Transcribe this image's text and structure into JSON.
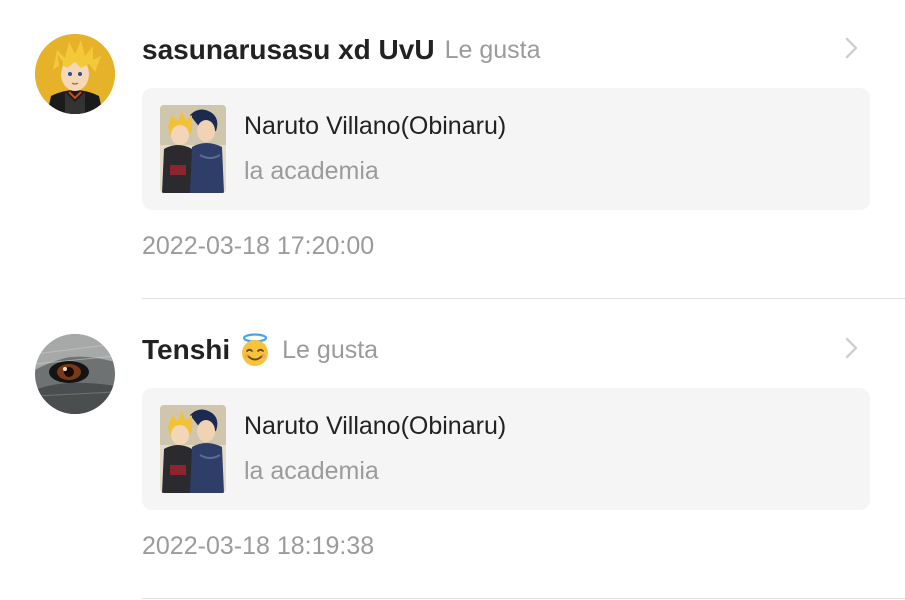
{
  "notifications": [
    {
      "user": "sasunarusasu xd UvU",
      "emoji": "",
      "action": "Le gusta",
      "story_title": "Naruto Villano(Obinaru)",
      "chapter": "la academia",
      "time": "2022-03-18 17:20:00",
      "avatar_icon": "blonde-anime-boy-avatar",
      "cover_icon": "book-cover-thumbnail"
    },
    {
      "user": "Tenshi",
      "emoji": "😇",
      "action": "Le gusta",
      "story_title": "Naruto Villano(Obinaru)",
      "chapter": "la academia",
      "time": "2022-03-18 18:19:38",
      "avatar_icon": "wolf-eye-avatar",
      "cover_icon": "book-cover-thumbnail"
    }
  ],
  "colors": {
    "primary_text": "#222222",
    "secondary_text": "#9b9b9b",
    "card_bg": "#f5f5f5",
    "divider": "#e2e2e2"
  }
}
